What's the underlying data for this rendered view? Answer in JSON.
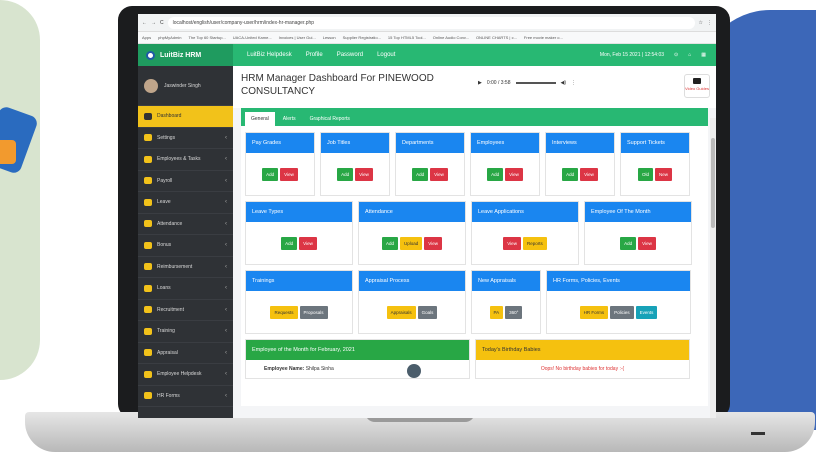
{
  "browser": {
    "url": "localhost/english/user/company-user/hrm/index-hr-manager.php",
    "bookmarks": [
      "Apps",
      "phpMyAdmin",
      "The Top 60 Startup...",
      "UACA-United Kame...",
      "Invoices | User Gui...",
      "Lesson",
      "Supplier Registratio...",
      "15 Top HTML5 Tool...",
      "Online Audio Conv...",
      "ONLINE CHARTS | c...",
      "Free movie maker o..."
    ]
  },
  "app": {
    "brand": "LuitBiz HRM",
    "topnav": [
      "LuitBiz Helpdesk",
      "Profile",
      "Password",
      "Logout"
    ],
    "datetime": "Mon, Feb 15 2021 | 12:54:03"
  },
  "sidebar": {
    "user": "Jaswinder Singh",
    "items": [
      {
        "label": "Dashboard",
        "active": true
      },
      {
        "label": "Settings"
      },
      {
        "label": "Employees & Tasks"
      },
      {
        "label": "Payroll"
      },
      {
        "label": "Leave"
      },
      {
        "label": "Attendance"
      },
      {
        "label": "Bonus"
      },
      {
        "label": "Reimbursement"
      },
      {
        "label": "Loans"
      },
      {
        "label": "Recruitment"
      },
      {
        "label": "Training"
      },
      {
        "label": "Appraisal"
      },
      {
        "label": "Employee Helpdesk"
      },
      {
        "label": "HR Forms"
      }
    ]
  },
  "main": {
    "title": "HRM Manager Dashboard For PINEWOOD CONSULTANCY",
    "player_time": "0:00 / 3:58",
    "video_guides": "Video Guides",
    "tabs": [
      "General",
      "Alerts",
      "Graphical Reports"
    ],
    "row1": [
      {
        "title": "Pay Grades",
        "buttons": [
          {
            "label": "Add",
            "c": "g"
          },
          {
            "label": "View",
            "c": "r"
          }
        ]
      },
      {
        "title": "Job Titles",
        "buttons": [
          {
            "label": "Add",
            "c": "g"
          },
          {
            "label": "View",
            "c": "r"
          }
        ]
      },
      {
        "title": "Departments",
        "buttons": [
          {
            "label": "Add",
            "c": "g"
          },
          {
            "label": "View",
            "c": "r"
          }
        ]
      },
      {
        "title": "Employees",
        "buttons": [
          {
            "label": "Add",
            "c": "g"
          },
          {
            "label": "View",
            "c": "r"
          }
        ]
      },
      {
        "title": "Interviews",
        "buttons": [
          {
            "label": "Add",
            "c": "g"
          },
          {
            "label": "View",
            "c": "r"
          }
        ]
      },
      {
        "title": "Support Tickets",
        "buttons": [
          {
            "label": "Old",
            "c": "g"
          },
          {
            "label": "New",
            "c": "r"
          }
        ]
      }
    ],
    "row2": [
      {
        "title": "Leave Types",
        "buttons": [
          {
            "label": "Add",
            "c": "g"
          },
          {
            "label": "View",
            "c": "r"
          }
        ]
      },
      {
        "title": "Attendance",
        "buttons": [
          {
            "label": "Add",
            "c": "g"
          },
          {
            "label": "Upload",
            "c": "y"
          },
          {
            "label": "View",
            "c": "r"
          }
        ]
      },
      {
        "title": "Leave Applications",
        "buttons": [
          {
            "label": "View",
            "c": "r"
          },
          {
            "label": "Reports",
            "c": "y"
          }
        ]
      },
      {
        "title": "Employee Of The Month",
        "buttons": [
          {
            "label": "Add",
            "c": "g"
          },
          {
            "label": "View",
            "c": "r"
          }
        ]
      }
    ],
    "row3": [
      {
        "title": "Trainings",
        "buttons": [
          {
            "label": "Requests",
            "c": "y"
          },
          {
            "label": "Proposals",
            "c": "s"
          }
        ]
      },
      {
        "title": "Appraisal Process",
        "buttons": [
          {
            "label": "Appraisals",
            "c": "y"
          },
          {
            "label": "Goals",
            "c": "s"
          }
        ]
      },
      {
        "title": "New Appraisals",
        "buttons": [
          {
            "label": "PA",
            "c": "y"
          },
          {
            "label": "360°",
            "c": "s"
          }
        ]
      },
      {
        "title": "HR Forms, Policies, Events",
        "buttons": [
          {
            "label": "HR Forms",
            "c": "y"
          },
          {
            "label": "Policies",
            "c": "s"
          },
          {
            "label": "Events",
            "c": "t"
          }
        ]
      }
    ],
    "employee_month": {
      "title": "Employee of the Month for February, 2021",
      "label": "Employee Name:",
      "name": "Shilpa Sinha"
    },
    "birthday": {
      "title": "Today's Birthday Babies",
      "message": "Oops! No birthday babies for today :-("
    }
  }
}
